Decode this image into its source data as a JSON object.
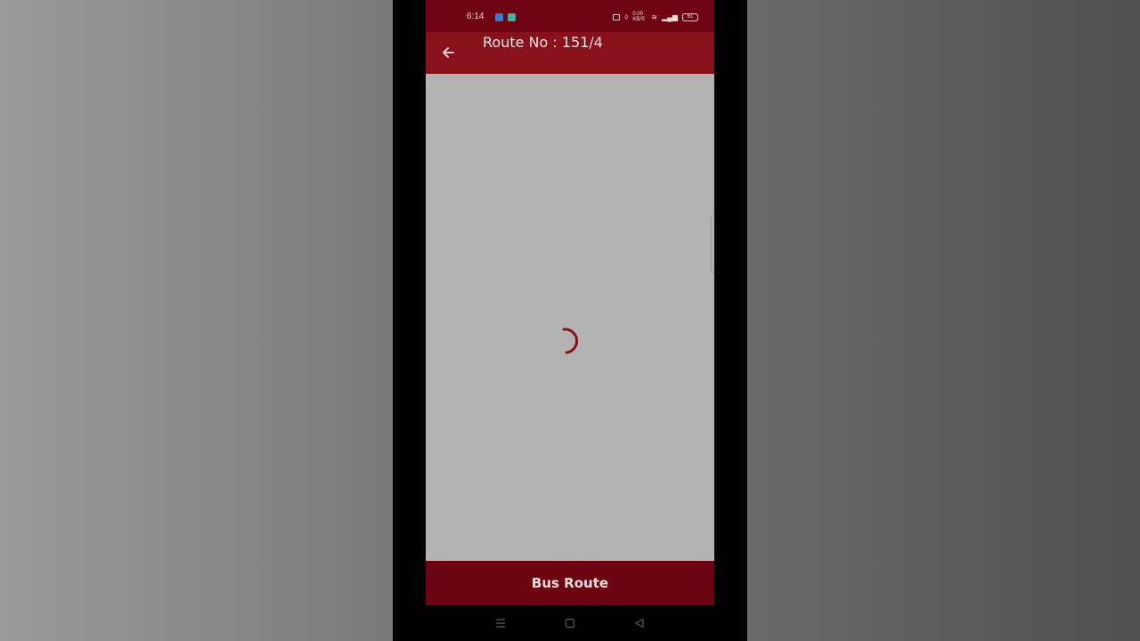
{
  "status_bar": {
    "time": "6:14",
    "network_speed": "0.00 KB/S",
    "battery": "61"
  },
  "app_bar": {
    "title": "Route No : 151/4",
    "back_icon": "arrow-left-icon"
  },
  "content": {
    "loading_indicator": "spinner-icon"
  },
  "bottom_button": {
    "label": "Bus Route"
  },
  "nav_bar": {
    "menu_icon": "menu-icon",
    "home_icon": "square-home-icon",
    "back_icon": "triangle-back-icon"
  },
  "colors": {
    "app_bar": "#88111c",
    "status_bar": "#6e0510",
    "button": "#6c0510",
    "content_bg": "#b3b3b3",
    "spinner": "#8b1019"
  }
}
